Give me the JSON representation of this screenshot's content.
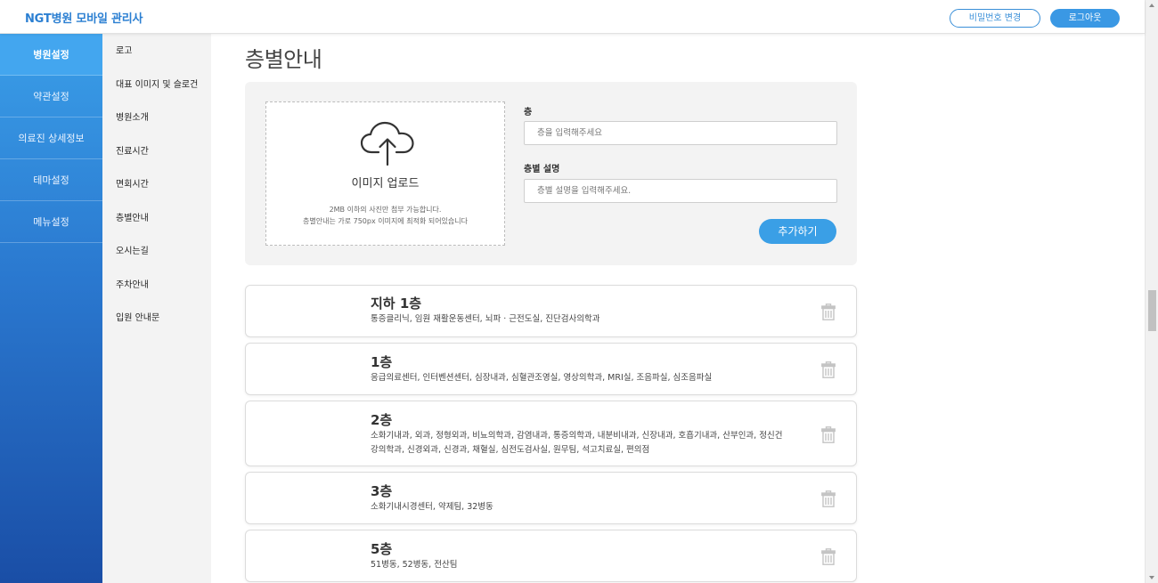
{
  "header": {
    "brand": "NGT병원 모바일 관리사",
    "change_password": "비밀번호 변경",
    "logout": "로그아웃"
  },
  "nav_primary": [
    {
      "label": "병원설정",
      "active": true
    },
    {
      "label": "약관설정",
      "active": false
    },
    {
      "label": "의료진 상세정보",
      "active": false
    },
    {
      "label": "테마설정",
      "active": false
    },
    {
      "label": "메뉴설정",
      "active": false
    }
  ],
  "nav_secondary": [
    {
      "label": "로고"
    },
    {
      "label": "대표 이미지 및 슬로건"
    },
    {
      "label": "병원소개"
    },
    {
      "label": "진료시간"
    },
    {
      "label": "면회시간"
    },
    {
      "label": "층별안내"
    },
    {
      "label": "오시는길"
    },
    {
      "label": "주차안내"
    },
    {
      "label": "입원 안내문"
    }
  ],
  "page": {
    "title": "층별안내"
  },
  "upload": {
    "title": "이미지 업로드",
    "note_line1": "2MB 이하의 사진만 첨부 가능합니다.",
    "note_line2": "층별안내는 가로 750px 이미지에 최적화 되어있습니다"
  },
  "form": {
    "floor_label": "층",
    "floor_placeholder": "층을 입력해주세요",
    "floor_value": "",
    "desc_label": "층별 설명",
    "desc_placeholder": "층별 설명을 입력해주세요.",
    "desc_value": "",
    "add_button": "추가하기"
  },
  "floors": [
    {
      "name": "지하 1층",
      "desc": "통증클리닉, 임원 재활운동센터, 뇌파 · 근전도실, 진단검사의학과"
    },
    {
      "name": "1층",
      "desc": "응급의료센터, 인터벤션센터, 심장내과, 심혈관조영실, 영상의학과, MRI실, 조음파실, 심조음파실"
    },
    {
      "name": "2층",
      "desc": "소화기내과, 외과, 정형외과, 비뇨의학과, 감염내과, 통증의학과, 내분비내과, 신장내과, 호흡기내과, 산부인과, 정신건강의학과, 신경외과, 신경과, 채혈실, 심전도검사실, 원무팀, 석고치료실, 편의점"
    },
    {
      "name": "3층",
      "desc": "소화기내시경센터, 약제팀, 32병동"
    },
    {
      "name": "5층",
      "desc": "51병동, 52병동, 전산팀"
    }
  ],
  "icons": {
    "upload": "cloud-upload-icon",
    "delete": "trash-icon"
  },
  "colors": {
    "accent": "#3a9fe6",
    "brand_text": "#2b7fd2",
    "nav_active": "#43a6ef"
  }
}
